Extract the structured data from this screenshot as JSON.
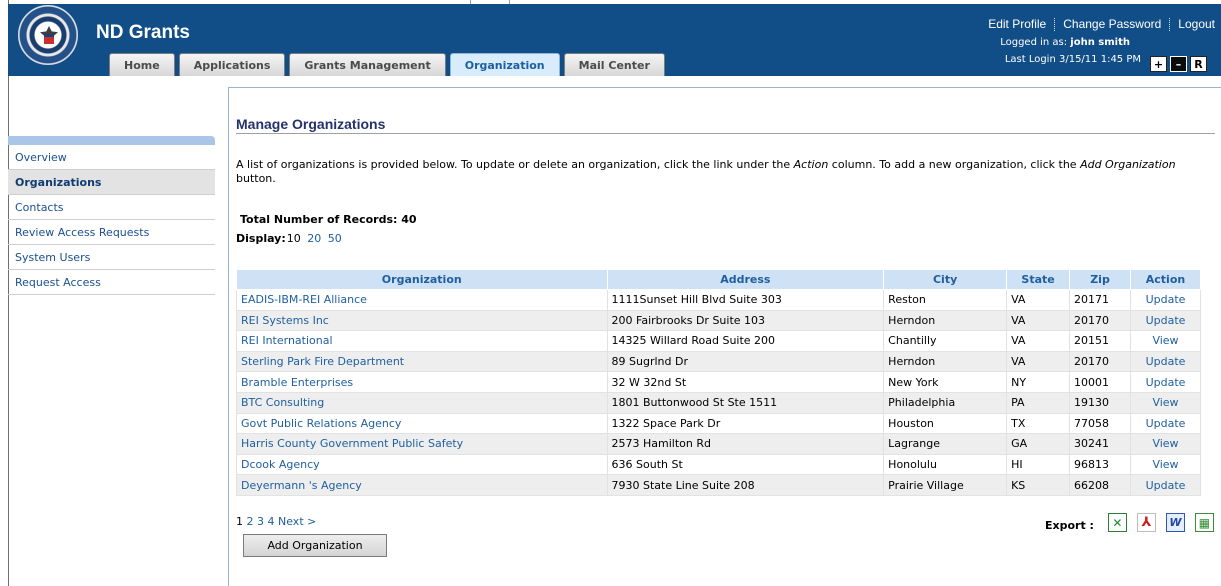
{
  "app": {
    "title": "ND Grants",
    "seal_text": "U.S. DEPARTMENT OF HOMELAND SECURITY",
    "brand_color": "#114d86"
  },
  "header": {
    "links": [
      "Edit Profile",
      "Change Password",
      "Logout"
    ],
    "logged_in_prefix": "Logged in as:",
    "user_name": "john smith",
    "last_login": "Last Login 3/15/11 1:45 PM",
    "font_buttons": [
      "+",
      "–",
      "R"
    ]
  },
  "tabs": [
    {
      "label": "Home",
      "active": false
    },
    {
      "label": "Applications",
      "active": false
    },
    {
      "label": "Grants Management",
      "active": false
    },
    {
      "label": "Organization",
      "active": true
    },
    {
      "label": "Mail Center",
      "active": false
    }
  ],
  "sidebar": {
    "items": [
      {
        "label": "Overview",
        "active": false
      },
      {
        "label": "Organizations",
        "active": true
      },
      {
        "label": "Contacts",
        "active": false
      },
      {
        "label": "Review Access Requests",
        "active": false
      },
      {
        "label": "System Users",
        "active": false
      },
      {
        "label": "Request Access",
        "active": false
      }
    ]
  },
  "main": {
    "title": "Manage Organizations",
    "intro_part1": "A list of organizations is provided below. To update or delete an organization, click the link under the ",
    "intro_action": "Action",
    "intro_part2": " column. To add a new organization, click the ",
    "intro_add": "Add Organization",
    "intro_part3": " button.",
    "total_records_label": "Total Number of Records: 40",
    "display_label": "Display:",
    "display_current": "10",
    "display_options": [
      "20",
      "50"
    ]
  },
  "table": {
    "columns": [
      "Organization",
      "Address",
      "City",
      "State",
      "Zip",
      "Action"
    ],
    "rows": [
      {
        "org": "EADIS-IBM-REI Alliance",
        "address": "1111Sunset Hill Blvd Suite 303",
        "city": "Reston",
        "state": "VA",
        "zip": "20171",
        "action": "Update"
      },
      {
        "org": "REI Systems Inc",
        "address": "200 Fairbrooks Dr Suite 103",
        "city": "Herndon",
        "state": "VA",
        "zip": "20170",
        "action": "Update"
      },
      {
        "org": "REI International",
        "address": "14325 Willard Road Suite 200",
        "city": "Chantilly",
        "state": "VA",
        "zip": "20151",
        "action": "View"
      },
      {
        "org": "Sterling Park Fire Department",
        "address": "89 Sugrlnd Dr",
        "city": "Herndon",
        "state": "VA",
        "zip": "20170",
        "action": "Update"
      },
      {
        "org": "Bramble Enterprises",
        "address": "32 W 32nd St",
        "city": "New York",
        "state": "NY",
        "zip": "10001",
        "action": "Update"
      },
      {
        "org": "BTC Consulting",
        "address": "1801 Buttonwood St Ste 1511",
        "city": "Philadelphia",
        "state": "PA",
        "zip": "19130",
        "action": "View"
      },
      {
        "org": "Govt Public Relations Agency",
        "address": "1322 Space Park Dr",
        "city": "Houston",
        "state": "TX",
        "zip": "77058",
        "action": "Update"
      },
      {
        "org": "Harris County Government Public Safety",
        "address": "2573 Hamilton Rd",
        "city": "Lagrange",
        "state": "GA",
        "zip": "30241",
        "action": "View"
      },
      {
        "org": "Dcook Agency",
        "address": "636 South St",
        "city": "Honolulu",
        "state": "HI",
        "zip": "96813",
        "action": "View"
      },
      {
        "org": "Deyermann 's Agency",
        "address": "7930 State Line Suite 208",
        "city": "Prairie Village",
        "state": "KS",
        "zip": "66208",
        "action": "Update"
      }
    ]
  },
  "pager": {
    "current": "1",
    "pages": [
      "2",
      "3",
      "4"
    ],
    "next": "Next >"
  },
  "buttons": {
    "add_organization": "Add Organization"
  },
  "export": {
    "label": "Export :",
    "icons": [
      "excel-icon",
      "pdf-icon",
      "word-icon",
      "csv-icon"
    ]
  }
}
